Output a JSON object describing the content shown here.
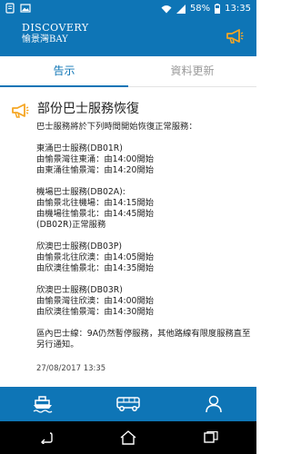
{
  "status_bar": {
    "battery": "58%",
    "time": "13:35",
    "icons_left": [
      "notification-icon",
      "photo-icon"
    ],
    "icons_right": [
      "wifi-icon",
      "signal-icon",
      "battery-icon"
    ]
  },
  "app_bar": {
    "logo_line1": "DISCOVERY",
    "logo_line2": "愉景灣BAY",
    "action_icon": "megaphone-icon"
  },
  "tabs": [
    {
      "label": "告示",
      "active": true
    },
    {
      "label": "資料更新",
      "active": false
    }
  ],
  "notice": {
    "icon": "megaphone-icon",
    "title": "部份巴士服務恢復",
    "body": "巴士服務將於下列時間開始恢復正常服務：\n\n東涌巴士服務(DB01R)\n由愉景灣往東涌：由14:00開始\n由東涌往愉景灣：由14:20開始\n\n機場巴士服務(DB02A):\n由愉景北往機場：由14:15開始\n由機場往愉景北：由14:45開始\n(DB02R)正常服務\n\n欣澳巴士服務(DB03P)\n由愉景北往欣澳：由14:05開始\n由欣澳往愉景北：由14:35開始\n\n欣澳巴士服務(DB03R)\n由愉景灣往欣澳：由14:00開始\n由欣澳往愉景灣：由14:30開始\n\n區內巴士線：9A仍然暫停服務，其他路線有限度服務直至另行通知。",
    "date": "27/08/2017 13:35"
  },
  "bottom_nav": [
    {
      "icon": "ferry-icon"
    },
    {
      "icon": "bus-icon"
    },
    {
      "icon": "user-icon"
    }
  ],
  "system_nav": [
    {
      "icon": "back-icon"
    },
    {
      "icon": "home-icon"
    },
    {
      "icon": "recents-icon"
    }
  ],
  "colors": {
    "primary": "#0e75b6",
    "accent": "#f5a623"
  }
}
